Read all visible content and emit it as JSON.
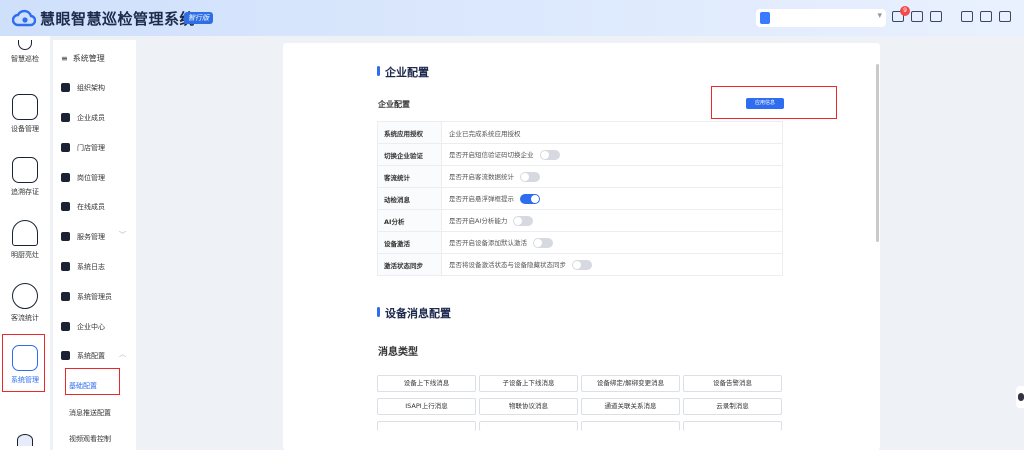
{
  "header": {
    "app_title": "慧眼智慧巡检管理系统",
    "edition_badge": "智行版",
    "notification_count": "9",
    "colors": {
      "brand": "#2e6cf0",
      "header_bg": "#dde9fd",
      "alert": "#f34b4b"
    },
    "icons": [
      "org-icon",
      "notification-icon",
      "message-icon",
      "help-icon",
      "download-icon",
      "fullscreen-icon",
      "settings-icon"
    ]
  },
  "rail": {
    "items": [
      {
        "label": "智慧巡检",
        "icon": "inspection-icon"
      },
      {
        "label": "设备管理",
        "icon": "device-icon"
      },
      {
        "label": "追溯存证",
        "icon": "trace-icon"
      },
      {
        "label": "明厨亮灶",
        "icon": "kitchen-icon"
      },
      {
        "label": "客流统计",
        "icon": "traffic-icon"
      },
      {
        "label": "系统管理",
        "icon": "system-icon",
        "active": true
      }
    ]
  },
  "submenu": {
    "heading": "系统管理",
    "items": [
      {
        "label": "组织架构",
        "icon": "org-tree-icon"
      },
      {
        "label": "企业成员",
        "icon": "member-icon"
      },
      {
        "label": "门店管理",
        "icon": "store-icon"
      },
      {
        "label": "岗位管理",
        "icon": "post-icon"
      },
      {
        "label": "在线成员",
        "icon": "online-icon"
      },
      {
        "label": "服务管理",
        "icon": "service-icon"
      },
      {
        "label": "系统日志",
        "icon": "log-icon"
      },
      {
        "label": "系统管理员",
        "icon": "admin-icon"
      },
      {
        "label": "企业中心",
        "icon": "enterprise-icon"
      },
      {
        "label": "系统配置",
        "icon": "config-icon"
      }
    ],
    "children": [
      {
        "label": "基础配置",
        "active": true
      },
      {
        "label": "消息推送配置"
      },
      {
        "label": "视频观看控制"
      }
    ]
  },
  "enterprise_config": {
    "section_title": "企业配置",
    "subtitle": "企业配置",
    "app_info_button": "应用信息",
    "rows": [
      {
        "key": "系统应用授权",
        "desc": "企业已完成系统应用授权",
        "switch": null
      },
      {
        "key": "切换企业验证",
        "desc": "是否开启短信验证码切换企业",
        "switch": false
      },
      {
        "key": "客流统计",
        "desc": "是否开启客流数据统计",
        "switch": false
      },
      {
        "key": "动检消息",
        "desc": "是否开启悬浮弹框提示",
        "switch": true
      },
      {
        "key": "AI分析",
        "desc": "是否开启AI分析能力",
        "switch": false
      },
      {
        "key": "设备激活",
        "desc": "是否开启设备添加默认激活",
        "switch": false
      },
      {
        "key": "激活状态同步",
        "desc": "是否将设备激活状态与设备隐藏状态同步",
        "switch": false
      }
    ]
  },
  "device_msg_config": {
    "section_title": "设备消息配置",
    "subtitle": "消息类型",
    "types": [
      "设备上下线消息",
      "子设备上下线消息",
      "设备绑定/解绑变更消息",
      "设备告警消息",
      "ISAPI上行消息",
      "物联协议消息",
      "通道关联关系消息",
      "云录制消息"
    ]
  }
}
